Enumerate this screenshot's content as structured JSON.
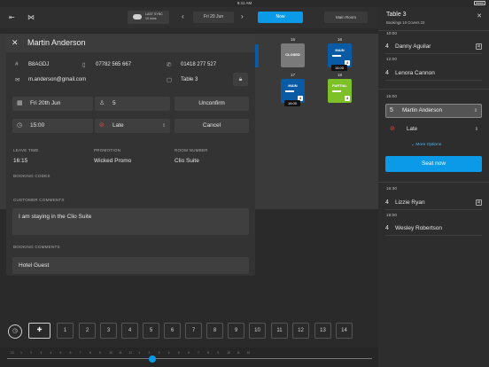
{
  "status_bar": {
    "time": "9:41 AM"
  },
  "topbar": {
    "sync_title": "LAST SYNC",
    "sync_sub": "10 mins",
    "date": "Fri 20 Jun",
    "now_label": "Now",
    "room_label": "Main Room"
  },
  "floor": {
    "tables": [
      {
        "number": "15",
        "label": "CLOSED",
        "color": "#7a7a7a"
      },
      {
        "number": "16",
        "label": "MAIN",
        "color": "#0a5ba6",
        "badge": "4",
        "time": "16:00"
      },
      {
        "number": "17",
        "label": "MAIN",
        "color": "#0a5ba6",
        "badge": "4",
        "time": "16:00"
      },
      {
        "number": "18",
        "label": "PARTIAL",
        "color": "#7dc028",
        "badge": "4"
      }
    ]
  },
  "panel": {
    "guest_name": "Martin Anderson",
    "booking_ref": "B8AGDJ",
    "mobile": "07782 565 667",
    "phone": "01418 277 527",
    "email": "m.anderson@gmail.com",
    "table": "Table 3",
    "date": "Fri 20th Jun",
    "covers": "5",
    "unconfirm_label": "Unconfirm",
    "time": "15:00",
    "status": "Late",
    "cancel_label": "Cancel",
    "leave_time_label": "LEAVE TIME",
    "leave_time": "16:15",
    "promotion_label": "PROMOTION",
    "promotion": "Wicked Promo",
    "room_number_label": "ROOM NUMBER",
    "room_number": "Clio Suite",
    "booking_codes_label": "BOOKING CODES",
    "customer_comments_label": "CUSTOMER COMMENTS",
    "customer_comments": "I am staying in the Clio Suite",
    "booking_comments_label": "BOOKING COMMENTS",
    "booking_comments": "Hotel Guest"
  },
  "bottombar": {
    "numbers": [
      "1",
      "2",
      "3",
      "4",
      "5",
      "6",
      "7",
      "8",
      "9",
      "10",
      "11",
      "12",
      "13",
      "14"
    ]
  },
  "timeline": {
    "ticks": [
      "12",
      "1",
      "2",
      "3",
      "4",
      "5",
      "6",
      "7",
      "8",
      "9",
      "10",
      "11",
      "12",
      "1",
      "2",
      "3",
      "4",
      "5",
      "6",
      "7",
      "8",
      "9",
      "10",
      "11",
      "12"
    ]
  },
  "sidebar": {
    "title": "Table 3",
    "subtitle": "Bookings 10  Covers 23",
    "slots": [
      {
        "time": "10:00",
        "count": "4",
        "name": "Danny Aguilar",
        "has_icon": true
      },
      {
        "time": "12:00",
        "count": "4",
        "name": "Lenora Cannon",
        "has_icon": false
      }
    ],
    "active_time": "15:00",
    "active_count": "5",
    "active_name": "Martin Anderson",
    "active_status": "Late",
    "more_options": "More Options",
    "seat_now": "Seat now",
    "later_slots": [
      {
        "time": "16:30",
        "count": "4",
        "name": "Lizzie Ryan",
        "has_icon": true
      },
      {
        "time": "18:00",
        "count": "4",
        "name": "Wesley Robertson",
        "has_icon": false
      }
    ]
  },
  "colors": {
    "accent": "#0a9ae8",
    "main_table": "#0a5ba6",
    "partial_table": "#7dc028",
    "closed_table": "#7a7a7a",
    "late_icon": "#e2483d"
  }
}
